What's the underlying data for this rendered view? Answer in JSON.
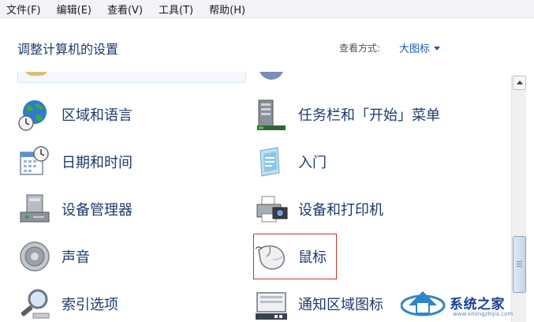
{
  "menu": {
    "items": [
      "文件(F)",
      "编辑(E)",
      "查看(V)",
      "工具(T)",
      "帮助(H)"
    ]
  },
  "header": {
    "title": "调整计算机的设置",
    "view_mode_label": "查看方式:",
    "view_mode_value": "大图标"
  },
  "items": {
    "region": "区域和语言",
    "taskbar": "任务栏和「开始」菜单",
    "datetime": "日期和时间",
    "getting_started": "入门",
    "device_manager": "设备管理器",
    "devices_printers": "设备和打印机",
    "sound": "声音",
    "mouse": "鼠标",
    "indexing": "索引选项",
    "notification_icons": "通知区域图标"
  },
  "icons": {
    "region": "globe-clock-icon",
    "taskbar": "taskbar-tower-icon",
    "datetime": "calendar-clock-icon",
    "getting_started": "getting-started-icon",
    "device_manager": "device-manager-icon",
    "devices_printers": "printer-camera-icon",
    "sound": "speaker-icon",
    "mouse": "mouse-icon",
    "indexing": "magnifier-icon",
    "notification_icons": "notification-tray-icon"
  },
  "highlighted_item": "mouse",
  "colors": {
    "link": "#1e3a6e",
    "accent": "#1e5aa8",
    "highlight_border": "#c3322f"
  },
  "watermark": {
    "text": "系统之家",
    "subtext": "www.xitongzhijia.com"
  }
}
